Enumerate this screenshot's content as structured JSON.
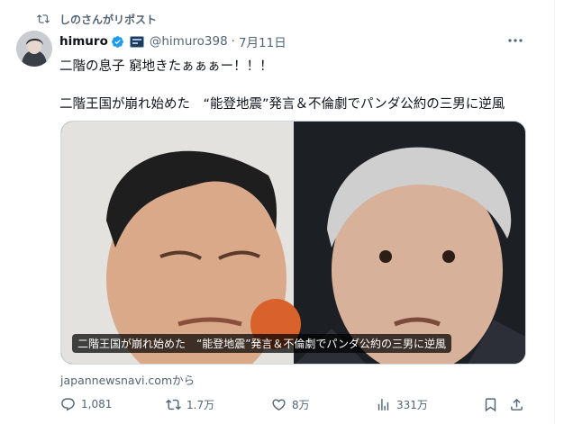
{
  "repost_banner": {
    "text": "しのさんがリポスト",
    "icon": "repost-icon"
  },
  "tweet": {
    "author": {
      "display_name": "himuro",
      "handle": "@himuro398",
      "verified": true
    },
    "separator": "·",
    "date": "7月11日",
    "text_line1": "二階の息子 窮地きたぁぁぁー！！！",
    "text_line2": "二階王国が崩れ始めた　“能登地震”発言＆不倫劇でパンダ公約の三男に逆風",
    "card": {
      "caption": "二階王国が崩れ始めた　“能登地震”発言＆不倫劇でパンダ公約の三男に逆風",
      "source": "japannewsnavi.comから"
    },
    "actions": {
      "replies": "1,081",
      "reposts": "1.7万",
      "likes": "8万",
      "views": "331万"
    }
  },
  "colors": {
    "text": "#0f1419",
    "muted": "#536471",
    "verified": "#1d9bf0",
    "border": "#cfd9de"
  }
}
